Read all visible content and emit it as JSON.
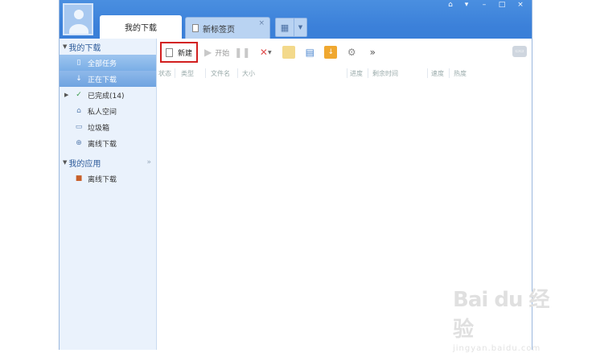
{
  "tabs": {
    "active_label": "我的下载",
    "second_label": "新标签页",
    "close_glyph": "×"
  },
  "window_controls": [
    "⌂",
    "▾",
    "–",
    "□",
    "×"
  ],
  "sidebar": {
    "section1": {
      "label": "我的下载"
    },
    "items": [
      {
        "label": "全部任务",
        "icon": "file-icon"
      },
      {
        "label": "正在下载",
        "icon": "download-arrow-icon"
      },
      {
        "label": "已完成(14)",
        "icon": "check-icon"
      },
      {
        "label": "私人空间",
        "icon": "lock-icon"
      },
      {
        "label": "垃圾箱",
        "icon": "trash-icon"
      },
      {
        "label": "离线下载",
        "icon": "offline-icon"
      }
    ],
    "section2": {
      "label": "我的应用",
      "more": "»"
    },
    "app_items": [
      {
        "label": "离线下载",
        "icon": "app-offline-icon"
      }
    ]
  },
  "toolbar": {
    "new_label": "新建",
    "start_label": "开始",
    "more": "»"
  },
  "columns": [
    "状态",
    "类型",
    "文件名",
    "大小",
    "进度",
    "剩余时间",
    "速度",
    "热度"
  ],
  "watermark": {
    "brand": "Bai du 经验",
    "url": "jingyan.baidu.com"
  }
}
